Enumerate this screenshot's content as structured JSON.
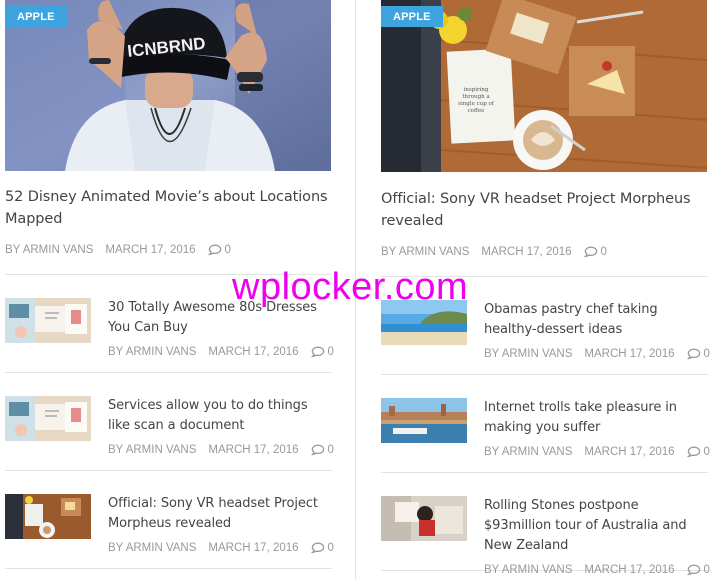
{
  "left": {
    "featured": {
      "badge": "APPLE",
      "title": "52 Disney Animated Movie’s about Locations Mapped",
      "author": "BY ARMIN VANS",
      "date": "MARCH 17, 2016",
      "comments": "0",
      "image_icon": "cap-man-photo"
    },
    "items": [
      {
        "title": "30 Totally Awesome 80s Dresses You Can Buy",
        "author": "BY ARMIN VANS",
        "date": "MARCH 17, 2016",
        "comments": "0",
        "image_icon": "desk-flatlay-photo"
      },
      {
        "title": "Services allow you to do things like scan a document",
        "author": "BY ARMIN VANS",
        "date": "MARCH 17, 2016",
        "comments": "0",
        "image_icon": "desk-flatlay-photo"
      },
      {
        "title": "Official: Sony VR headset Project Morpheus revealed",
        "author": "BY ARMIN VANS",
        "date": "MARCH 17, 2016",
        "comments": "0",
        "image_icon": "coffee-table-photo"
      }
    ]
  },
  "right": {
    "featured": {
      "badge": "APPLE",
      "title": "Official: Sony VR headset Project Morpheus revealed",
      "author": "BY ARMIN VANS",
      "date": "MARCH 17, 2016",
      "comments": "0",
      "image_icon": "coffee-table-photo",
      "card_text": "inspiring through a single cup of coffee"
    },
    "items": [
      {
        "title": "Obamas pastry chef taking healthy-dessert ideas",
        "author": "BY ARMIN VANS",
        "date": "MARCH 17, 2016",
        "comments": "0",
        "image_icon": "beach-photo"
      },
      {
        "title": "Internet trolls take pleasure in making you suffer",
        "author": "BY ARMIN VANS",
        "date": "MARCH 17, 2016",
        "comments": "0",
        "image_icon": "city-river-photo"
      },
      {
        "title": "Rolling Stones postpone $93million tour of Australia and New Zealand",
        "author": "BY ARMIN VANS",
        "date": "MARCH 17, 2016",
        "comments": "0",
        "image_icon": "girl-reading-photo"
      }
    ]
  },
  "watermark": "wplocker.com",
  "colors": {
    "accent": "#3ea4e0",
    "meta": "#999999",
    "title": "#444444",
    "watermark": "#ee00ee"
  }
}
